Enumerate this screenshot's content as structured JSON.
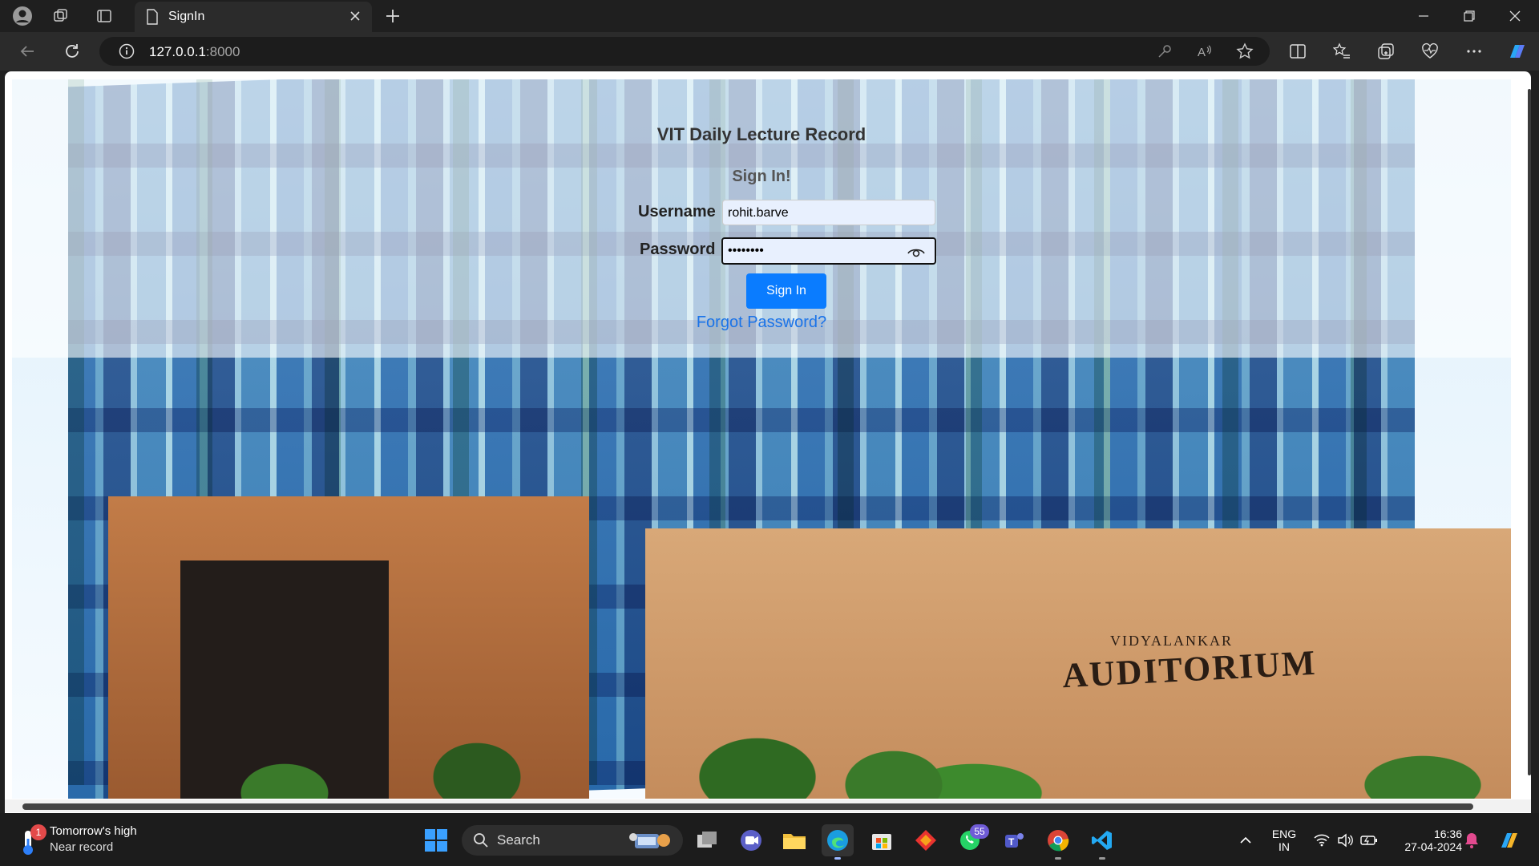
{
  "browser": {
    "tab_title": "SignIn",
    "url_host": "127.0.0.1",
    "url_port": ":8000"
  },
  "page": {
    "title": "VIT Daily Lecture Record",
    "subtitle": "Sign In!",
    "username_label": "Username",
    "username_value": "rohit.barve",
    "password_label": "Password",
    "password_mask": "••••••••",
    "signin_label": "Sign In",
    "forgot_label": "Forgot Password?",
    "background_text_top": "VIDYALANKAR",
    "background_text_main": "AUDITORIUM"
  },
  "taskbar": {
    "weather_line1": "Tomorrow's high",
    "weather_line2": "Near record",
    "weather_badge": "1",
    "search_label": "Search",
    "whatsapp_badge": "55",
    "lang_top": "ENG",
    "lang_bottom": "IN",
    "time": "16:36",
    "date": "27-04-2024"
  },
  "colors": {
    "accent_blue": "#0a7cff",
    "link_blue": "#1a73e8",
    "taskbar_bg": "#1c1c1c"
  }
}
